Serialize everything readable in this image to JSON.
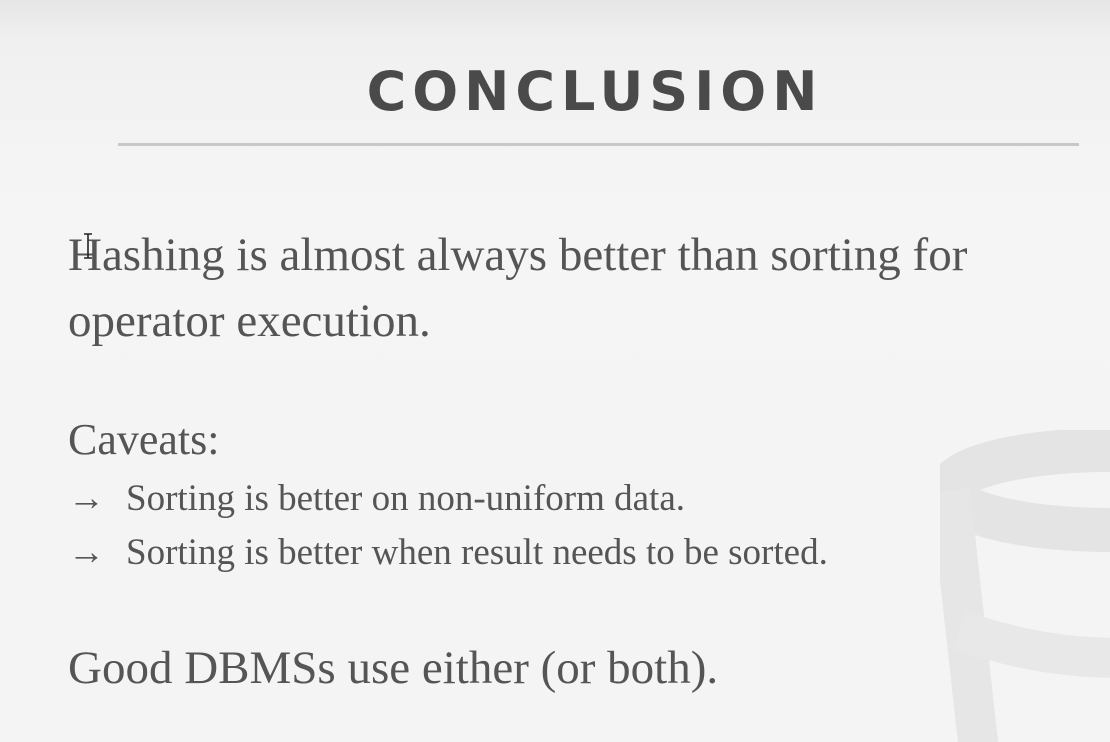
{
  "slide": {
    "title": "CONCLUSION",
    "main_statement": "Hashing is almost always better than sorting for operator execution.",
    "caveats_label": "Caveats:",
    "caveats": [
      {
        "arrow": "→",
        "text": "Sorting is better on non-uniform data."
      },
      {
        "arrow": "→",
        "text": "Sorting is better when result needs to be sorted."
      }
    ],
    "closing": "Good DBMSs use either (or both)."
  },
  "icons": {
    "cursor": "ibeam-cursor-icon",
    "watermark": "database-logo-watermark"
  },
  "colors": {
    "title": "#4a4a4a",
    "body_text": "#555555",
    "rule": "#c8c8c8",
    "background": "#f4f4f4"
  }
}
